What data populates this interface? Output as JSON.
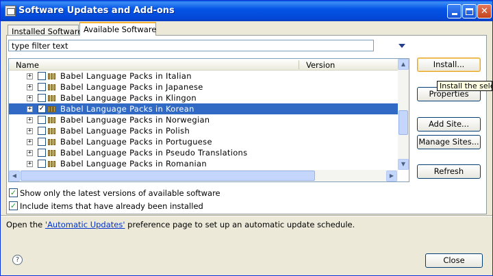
{
  "window": {
    "title": "Software Updates and Add-ons"
  },
  "tabs": [
    {
      "label": "Installed Software",
      "active": false
    },
    {
      "label": "Available Software",
      "active": true
    }
  ],
  "filter": {
    "value": "type filter text"
  },
  "tree": {
    "columns": [
      "Name",
      "Version"
    ],
    "rows": [
      {
        "label": "Babel Language Packs in Italian",
        "checked": false,
        "selected": false
      },
      {
        "label": "Babel Language Packs in Japanese",
        "checked": false,
        "selected": false
      },
      {
        "label": "Babel Language Packs in Klingon",
        "checked": false,
        "selected": false
      },
      {
        "label": "Babel Language Packs in Korean",
        "checked": true,
        "selected": true
      },
      {
        "label": "Babel Language Packs in Norwegian",
        "checked": false,
        "selected": false
      },
      {
        "label": "Babel Language Packs in Polish",
        "checked": false,
        "selected": false
      },
      {
        "label": "Babel Language Packs in Portuguese",
        "checked": false,
        "selected": false
      },
      {
        "label": "Babel Language Packs in Pseudo Translations",
        "checked": false,
        "selected": false
      },
      {
        "label": "Babel Language Packs in Romanian",
        "checked": false,
        "selected": false
      }
    ],
    "expander_glyph": "+",
    "check_glyph": "✓"
  },
  "buttons": {
    "install": "Install...",
    "properties": "Properties",
    "add_site": "Add Site...",
    "manage_sites": "Manage Sites...",
    "refresh": "Refresh",
    "close": "Close"
  },
  "tooltip": "Install the selec",
  "options": {
    "latest_only": {
      "label": "Show only the latest versions of available software",
      "checked": true
    },
    "include_installed": {
      "label": "Include items that have already been installed",
      "checked": true
    }
  },
  "info": {
    "before": "Open the ",
    "link": "'Automatic Updates'",
    "after": " preference page to set up an automatic update schedule."
  },
  "icons": {
    "help": "?",
    "scroll_up": "▲",
    "scroll_down": "▼",
    "scroll_left": "◀",
    "scroll_right": "▶"
  },
  "colors": {
    "title_bar": "#0555e6",
    "selection": "#316ac5",
    "dialog_bg": "#ece9d8",
    "link": "#0033cc"
  }
}
